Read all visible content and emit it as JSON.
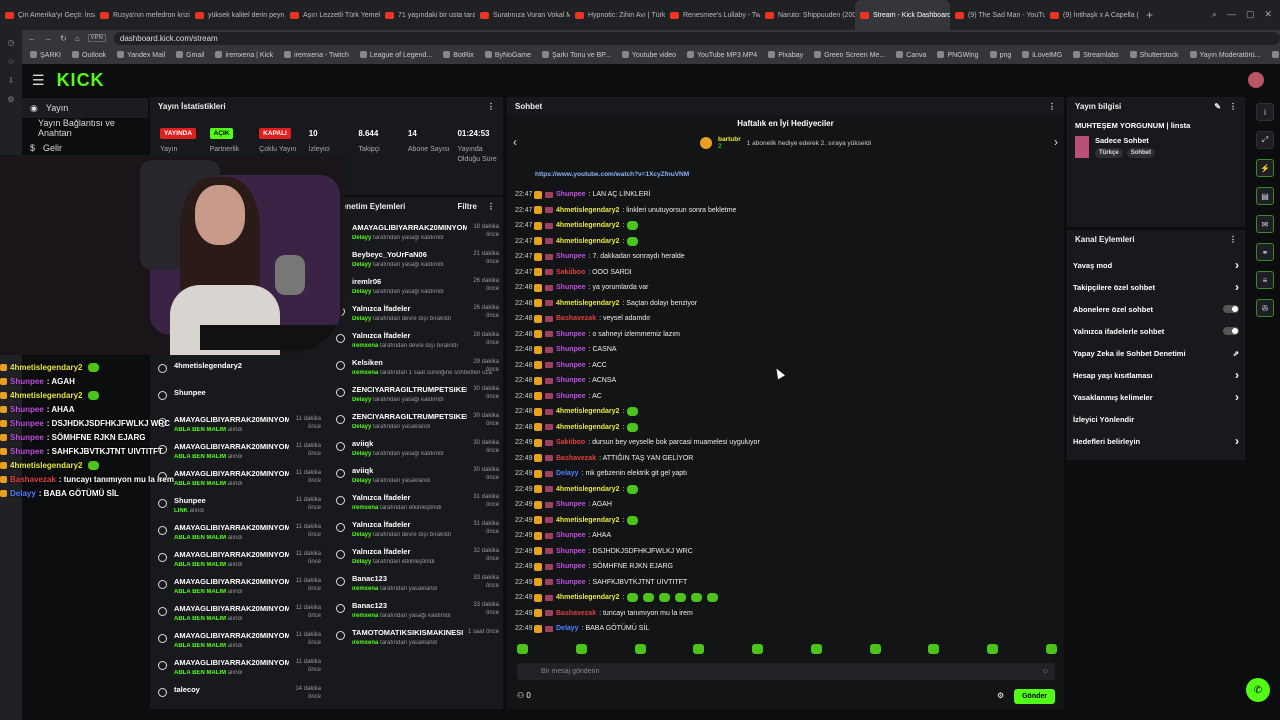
{
  "browser": {
    "tabs": [
      "Çin Amerika'yı Geçti: İnsan",
      "Rusya'nın mefedron krizi",
      "yüksek kalitel derin peyn",
      "Aşırı Lezzetli Türk Yemek",
      "71 yaşındaki bir usta taraf",
      "Suratınıza Vuran Vokal M",
      "Hypnotic: Zihin Avı | Türkç",
      "Renesmee's Lullaby - Twil",
      "Naruto: Shippuuden (200",
      "Stream - Kick Dashboard",
      "(9) The Sad Man - YouTu",
      "(9) İntihaşk x A Capella ("
    ],
    "active_tab": 9,
    "url": "dashboard.kick.com/stream",
    "vpn": "VPN",
    "bookmarks": [
      "ŞARKI",
      "Outlook",
      "Yandex Mail",
      "Gmail",
      "iremxena | Kick",
      "iremxena - Twitch",
      "League of Legend...",
      "BotRix",
      "ByNoGame",
      "Şarkı Tonu ve BP...",
      "Youtube video",
      "YouTube MP3 MP4",
      "Pixabay",
      "Green Screen Me...",
      "Canva",
      "PNGWing",
      "png",
      "iLoveIMG",
      "Streamlabs",
      "Shutterstock",
      "Yayın Moderatörü...",
      "xena (u/iremxena)..."
    ]
  },
  "app": {
    "logo": "KICK"
  },
  "nav": {
    "items": [
      "Yayın",
      "Yayın Bağlantısı ve Anahtarı",
      "Gelir"
    ]
  },
  "overlay_chat": [
    {
      "user": "4hmetislegendary2",
      "msg": "",
      "color": "#e8e840",
      "emote": true
    },
    {
      "user": "Shunpee",
      "msg": ": AGAH",
      "color": "#c050e0",
      "emote": false
    },
    {
      "user": "4hmetislegendary2",
      "msg": "",
      "color": "#e8e840",
      "emote": true
    },
    {
      "user": "Shunpee",
      "msg": ": AHAA",
      "color": "#c050e0",
      "emote": false
    },
    {
      "user": "Shunpee",
      "msg": ": DSJHDKJSDFHKJFWLKJ WRC",
      "color": "#c050e0",
      "emote": false
    },
    {
      "user": "Shunpee",
      "msg": ": SÖMHFNE RJKN EJARG",
      "color": "#c050e0",
      "emote": false
    },
    {
      "user": "Shunpee",
      "msg": ": SAHFKJBVTKJTNT UIVTITFT",
      "color": "#c050e0",
      "emote": false
    },
    {
      "user": "4hmetislegendary2",
      "msg": "",
      "color": "#e8e840",
      "emote": true
    },
    {
      "user": "Bashavezak",
      "msg": ": tuncayı tanımıyon mu la irem",
      "color": "#e04040",
      "emote": false
    },
    {
      "user": "Delayy",
      "msg": ": BABA GÖTÜMÜ SİL",
      "color": "#5080ff",
      "emote": false
    }
  ],
  "stats": {
    "title": "Yayın İstatistikleri",
    "items": [
      {
        "value": "YAYINDA",
        "type": "red",
        "label": "Yayın"
      },
      {
        "value": "AÇIK",
        "type": "green",
        "label": "Partnerlik Gelir"
      },
      {
        "value": "KAPALI",
        "type": "red",
        "label": "Çoklu Yayın"
      },
      {
        "value": "10",
        "type": "text",
        "label": "İzleyici"
      },
      {
        "value": "8.644",
        "type": "text",
        "label": "Takipçi"
      },
      {
        "value": "14",
        "type": "text",
        "label": "Abone Sayısı"
      },
      {
        "value": "01:24:53",
        "type": "text",
        "label": "Yayında Olduğu Süre"
      }
    ]
  },
  "modlog": {
    "title": "Denetim Eylemleri",
    "filter": "Filtre",
    "left": [
      {
        "name": "4hmetislegendary2",
        "who": "",
        "action": "",
        "time": ""
      },
      {
        "name": "Shunpee",
        "who": "",
        "action": "",
        "time": ""
      },
      {
        "name": "AMAYAGLIBIYARRAK20MINYOM",
        "who": "ABLA BEN MALIM",
        "action": "alındı",
        "time": "11 dakika önce"
      },
      {
        "name": "AMAYAGLIBIYARRAK20MINYOM",
        "who": "ABLA BEN MALIM",
        "action": "alındı",
        "time": "11 dakika önce"
      },
      {
        "name": "AMAYAGLIBIYARRAK20MINYOM",
        "who": "ABLA BEN MALIM",
        "action": "alındı",
        "time": "11 dakika önce"
      },
      {
        "name": "Shunpee",
        "who": "LİNK",
        "action": "alındı",
        "time": "11 dakika önce"
      },
      {
        "name": "AMAYAGLIBIYARRAK20MINYOM",
        "who": "ABLA BEN MALIM",
        "action": "alındı",
        "time": "11 dakika önce"
      },
      {
        "name": "AMAYAGLIBIYARRAK20MINYOM",
        "who": "ABLA BEN MALIM",
        "action": "alındı",
        "time": "11 dakika önce"
      },
      {
        "name": "AMAYAGLIBIYARRAK20MINYOM",
        "who": "ABLA BEN MALIM",
        "action": "alındı",
        "time": "11 dakika önce"
      },
      {
        "name": "AMAYAGLIBIYARRAK20MINYOM",
        "who": "ABLA BEN MALIM",
        "action": "alındı",
        "time": "11 dakika önce"
      },
      {
        "name": "AMAYAGLIBIYARRAK20MINYOM",
        "who": "ABLA BEN MALIM",
        "action": "alındı",
        "time": "11 dakika önce"
      },
      {
        "name": "AMAYAGLIBIYARRAK20MINYOM",
        "who": "ABLA BEN MALIM",
        "action": "alındı",
        "time": "11 dakika önce"
      },
      {
        "name": "talecoy",
        "who": "",
        "action": "",
        "time": "14 dakika önce"
      }
    ],
    "right": [
      {
        "name": "AMAYAGLIBIYARRAK20MINYOM",
        "who": "Delayy",
        "action": "tarafından yasağı kaldırıldı",
        "time": "18 dakika önce"
      },
      {
        "name": "Beybeyc_YoUrFaN06",
        "who": "Delayy",
        "action": "tarafından yasağı kaldırıldı",
        "time": "21 dakika önce"
      },
      {
        "name": "iremlr06",
        "who": "Delayy",
        "action": "tarafından yasağı kaldırıldı",
        "time": "26 dakika önce"
      },
      {
        "name": "Yalnızca İfadeler",
        "who": "Delayy",
        "action": "tarafından devre dışı bırakıldı",
        "time": "26 dakika önce"
      },
      {
        "name": "Yalnızca İfadeler",
        "who": "iremxena",
        "action": "tarafından devre dışı bırakıldı",
        "time": "28 dakika önce"
      },
      {
        "name": "Kelsiken",
        "who": "iremxena",
        "action": "tarafından 1 saat süreliğine sohbetten uzaklaştırıldı",
        "time": "29 dakika önce"
      },
      {
        "name": "ZENCIYARRAGILTRUMPETSIKEN",
        "who": "Delayy",
        "action": "tarafından yasağı kaldırıldı",
        "time": "30 dakika önce"
      },
      {
        "name": "ZENCIYARRAGILTRUMPETSIKEN",
        "who": "Delayy",
        "action": "tarafından yasaklandı",
        "time": "30 dakika önce"
      },
      {
        "name": "aviiqk",
        "who": "Delayy",
        "action": "tarafından yasağı kaldırıldı",
        "time": "30 dakika önce"
      },
      {
        "name": "aviiqk",
        "who": "Delayy",
        "action": "tarafından yasaklandı",
        "time": "30 dakika önce"
      },
      {
        "name": "Yalnızca İfadeler",
        "who": "iremxena",
        "action": "tarafından etkinleştirildi",
        "time": "31 dakika önce"
      },
      {
        "name": "Yalnızca İfadeler",
        "who": "Delayy",
        "action": "tarafından devre dışı bırakıldı",
        "time": "31 dakika önce"
      },
      {
        "name": "Yalnızca İfadeler",
        "who": "Delayy",
        "action": "tarafından etkinleştirildi",
        "time": "32 dakika önce"
      },
      {
        "name": "Banac123",
        "who": "iremxena",
        "action": "tarafından yasaklandı",
        "time": "33 dakika önce"
      },
      {
        "name": "Banac123",
        "who": "iremxena",
        "action": "tarafından yasağı kaldırıldı",
        "time": "33 dakika önce"
      },
      {
        "name": "TAMOTOMATIKSIKISMAKINESI",
        "who": "iremxena",
        "action": "tarafından yasaklandı",
        "time": "1 saat önce"
      }
    ]
  },
  "chat": {
    "title": "Sohbet",
    "gift_title": "Haftalık en İyi Hediyeciler",
    "gift_user": "bartubr",
    "gift_count": "2",
    "gift_text": "1 abonelik hediye ederek 2. sıraya yükseldi",
    "pinned_link": "https://www.youtube.com/watch?v=1XcyZfnuVNM",
    "messages": [
      {
        "time": "22:47",
        "user": "Shunpee",
        "msg": ": LAN AÇ LİNKLERİ",
        "color": "#c050e0",
        "emotes": 0
      },
      {
        "time": "22:47",
        "user": "4hmetislegendary2",
        "msg": ": linkleri unutuyorsun sonra bekletme",
        "color": "#e8e840",
        "emotes": 0
      },
      {
        "time": "22:47",
        "user": "4hmetislegendary2",
        "msg": ":",
        "color": "#e8e840",
        "emotes": 1
      },
      {
        "time": "22:47",
        "user": "4hmetislegendary2",
        "msg": ":",
        "color": "#e8e840",
        "emotes": 1
      },
      {
        "time": "22:47",
        "user": "Shunpee",
        "msg": ": 7. dakkadan sonraydı heralde",
        "color": "#c050e0",
        "emotes": 0
      },
      {
        "time": "22:47",
        "user": "Sakiiboo",
        "msg": ": OOO SARDI",
        "color": "#e04040",
        "emotes": 0
      },
      {
        "time": "22:48",
        "user": "Shunpee",
        "msg": ": ya yorumlarda var",
        "color": "#c050e0",
        "emotes": 0
      },
      {
        "time": "22:48",
        "user": "4hmetislegendary2",
        "msg": ": Saçtan dolayı benziyor",
        "color": "#e8e840",
        "emotes": 0
      },
      {
        "time": "22:48",
        "user": "Bashavezak",
        "msg": ": veysel adamdır",
        "color": "#e04040",
        "emotes": 0
      },
      {
        "time": "22:48",
        "user": "Shunpee",
        "msg": ": o sahneyi izlemmemiz lazım",
        "color": "#c050e0",
        "emotes": 0
      },
      {
        "time": "22:48",
        "user": "Shunpee",
        "msg": ": CASNA",
        "color": "#c050e0",
        "emotes": 0
      },
      {
        "time": "22:48",
        "user": "Shunpee",
        "msg": ": ACC",
        "color": "#c050e0",
        "emotes": 0
      },
      {
        "time": "22:48",
        "user": "Shunpee",
        "msg": ": ACNSA",
        "color": "#c050e0",
        "emotes": 0
      },
      {
        "time": "22:48",
        "user": "Shunpee",
        "msg": ": AC",
        "color": "#c050e0",
        "emotes": 0
      },
      {
        "time": "22:48",
        "user": "4hmetislegendary2",
        "msg": ":",
        "color": "#e8e840",
        "emotes": 1
      },
      {
        "time": "22:48",
        "user": "4hmetislegendary2",
        "msg": ":",
        "color": "#e8e840",
        "emotes": 1
      },
      {
        "time": "22:49",
        "user": "Sakiiboo",
        "msg": ": dursun bey veyselle bok parcasi muamelesi uyguluyor",
        "color": "#e04040",
        "emotes": 0
      },
      {
        "time": "22:49",
        "user": "Bashavezak",
        "msg": ": ATTIĞIN TAŞ YAN GELİYOR",
        "color": "#e04040",
        "emotes": 0
      },
      {
        "time": "22:49",
        "user": "Delayy",
        "msg": ": mk gebzenin elektrik git gel yaptı",
        "color": "#5080ff",
        "emotes": 0
      },
      {
        "time": "22:49",
        "user": "4hmetislegendary2",
        "msg": ":",
        "color": "#e8e840",
        "emotes": 1
      },
      {
        "time": "22:49",
        "user": "Shunpee",
        "msg": ": AGAH",
        "color": "#c050e0",
        "emotes": 0
      },
      {
        "time": "22:49",
        "user": "4hmetislegendary2",
        "msg": ":",
        "color": "#e8e840",
        "emotes": 1
      },
      {
        "time": "22:49",
        "user": "Shunpee",
        "msg": ": AHAA",
        "color": "#c050e0",
        "emotes": 0
      },
      {
        "time": "22:49",
        "user": "Shunpee",
        "msg": ": DSJHDKJSDFHKJFWLKJ WRC",
        "color": "#c050e0",
        "emotes": 0
      },
      {
        "time": "22:49",
        "user": "Shunpee",
        "msg": ": SÖMHFNE RJKN EJARG",
        "color": "#c050e0",
        "emotes": 0
      },
      {
        "time": "22:49",
        "user": "Shunpee",
        "msg": ": SAHFKJBVTKJTNT UIVTITFT",
        "color": "#c050e0",
        "emotes": 0
      },
      {
        "time": "22:49",
        "user": "4hmetislegendary2",
        "msg": ":",
        "color": "#e8e840",
        "emotes": 6
      },
      {
        "time": "22:49",
        "user": "Bashavezak",
        "msg": ": tuncayı tanımıyon mu la irem",
        "color": "#e04040",
        "emotes": 0
      },
      {
        "time": "22:49",
        "user": "Delayy",
        "msg": ": BABA GÖTÜMÜ SİL",
        "color": "#5080ff",
        "emotes": 0
      }
    ],
    "input_placeholder": "Bir mesaj gönderin",
    "points": "0",
    "send_label": "Gönder"
  },
  "stream_info": {
    "title": "Yayın bilgisi",
    "stream_title": "MUHTEŞEM YORGUNUM | linsta",
    "category": "Sadece Sohbet",
    "tags": [
      "Türkçe",
      "Sohbet"
    ]
  },
  "channel_actions": {
    "title": "Kanal Eylemleri",
    "items": [
      {
        "label": "Yavaş mod",
        "kind": "arrow"
      },
      {
        "label": "Takipçilere özel sohbet",
        "kind": "arrow"
      },
      {
        "label": "Abonelere özel sohbet",
        "kind": "toggle"
      },
      {
        "label": "Yalnızca ifadelerle sohbet",
        "kind": "toggle"
      },
      {
        "label": "Yapay Zeka ile Sohbet Denetimi",
        "kind": "ext"
      },
      {
        "label": "Hesap yaşı kısıtlaması",
        "kind": "arrow"
      },
      {
        "label": "Yasaklanmış kelimeler",
        "kind": "arrow"
      },
      {
        "label": "İzleyici Yönlendir",
        "kind": "none"
      },
      {
        "label": "Hedefleri belirleyin",
        "kind": "arrow"
      }
    ]
  },
  "colors": {
    "accent": "#53fc18",
    "live": "#e02020"
  }
}
